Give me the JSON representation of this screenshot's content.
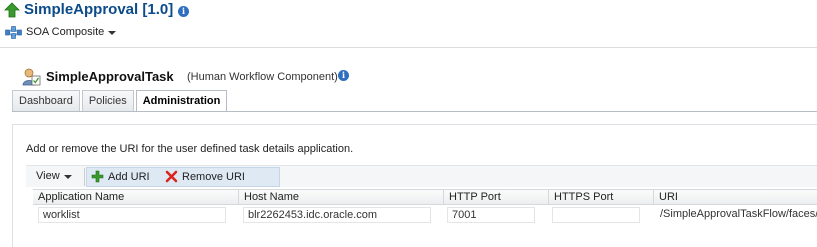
{
  "header": {
    "app_title": "SimpleApproval [1.0]",
    "composite_menu_label": "SOA Composite"
  },
  "task": {
    "title": "SimpleApprovalTask",
    "subtitle": "(Human Workflow Component)"
  },
  "tabs": [
    {
      "label": "Dashboard",
      "active": false
    },
    {
      "label": "Policies",
      "active": false
    },
    {
      "label": "Administration",
      "active": true
    }
  ],
  "administration": {
    "description": "Add or remove the URI for the user defined task details application.",
    "toolbar": {
      "view_label": "View",
      "add_uri_label": "Add URI",
      "remove_uri_label": "Remove URI"
    },
    "table": {
      "columns": [
        "Application Name",
        "Host Name",
        "HTTP Port",
        "HTTPS Port",
        "URI"
      ],
      "rows": [
        {
          "application_name": "worklist",
          "host_name": "blr2262453.idc.oracle.com",
          "http_port": "7001",
          "https_port": "",
          "uri": "/SimpleApprovalTaskFlow/faces/"
        }
      ]
    }
  },
  "icons": {
    "up_arrow": "green-up-arrow-icon",
    "info": "info-icon",
    "composite": "soa-composite-icon",
    "task": "human-task-icon",
    "add": "green-plus-icon",
    "remove": "red-x-icon"
  },
  "colors": {
    "title_blue": "#0b4b8a",
    "info_blue": "#2f6fbf",
    "add_green": "#3a9a2c",
    "remove_red": "#d9251d",
    "toolbar_button_bg": "#dfe9f4"
  }
}
